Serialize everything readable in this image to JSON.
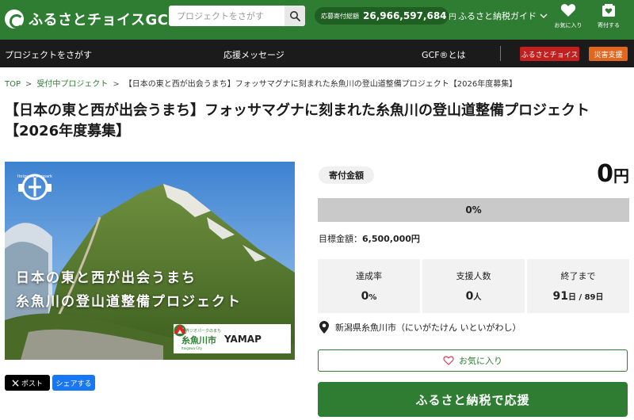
{
  "header": {
    "logo_text": "ふるさとチョイスGCF",
    "logo_reg": "®",
    "search": {
      "placeholder": "プロジェクトをさがす"
    },
    "total": {
      "label": "応募寄付総額",
      "amount": "26,966,597,684",
      "unit": "円"
    },
    "guide_label": "ふるさと納税ガイド",
    "favorites_label": "お気に入り",
    "donate_label": "寄付する"
  },
  "nav": {
    "find": "プロジェクトをさがす",
    "messages": "応援メッセージ",
    "about": "GCF®とは",
    "choice": "ふるさとチョイス",
    "disaster": "災害支援"
  },
  "breadcrumb": {
    "top": "TOP",
    "active": "受付中プロジェクト",
    "current": "【日本の東と西が出会うまち】フォッサマグナに刻まれた糸魚川の登山道整備プロジェクト【2026年度募集】"
  },
  "page_title": "【日本の東と西が出会うまち】フォッサマグナに刻まれた糸魚川の登山道整備プロジェクト【2026年度募集】",
  "hero": {
    "line1": "日本の東と西が出会うまち",
    "line2": "糸魚川の登山道整備プロジェクト",
    "geopark_label": "Itoigawa Geopark",
    "partner_sub": "世界ジオパークのまち",
    "partner_city": "糸魚川市",
    "partner_city_en": "Itoigawa City",
    "partner_yamap": "YAMAP"
  },
  "share": {
    "post": "ポスト",
    "share": "シェアする"
  },
  "donation": {
    "badge": "寄付金額",
    "amount": "0",
    "unit": "円",
    "progress_fraction": 0,
    "progress_text": "0%",
    "goal_label": "目標金額：",
    "goal_value": "6,500,000円"
  },
  "stats": {
    "rate_label": "達成率",
    "rate_value": "0",
    "rate_unit": "%",
    "supporters_label": "支援人数",
    "supporters_value": "0",
    "supporters_unit": "人",
    "remaining_label": "終了まで",
    "remaining_value": "91",
    "remaining_unit": "日",
    "remaining_total": " / 89日"
  },
  "location": "新潟県糸魚川市（にいがたけん いといがわし）",
  "favorite_button": "お気に入り",
  "donate_button": "ふるさと納税で応援",
  "colors": {
    "brand_green": "#2f7d32",
    "nav_bg": "#1b1b1b",
    "choice_red": "#c21f1f",
    "disaster_orange": "#e2661d",
    "x_black": "#000000",
    "share_blue": "#1877f2"
  }
}
